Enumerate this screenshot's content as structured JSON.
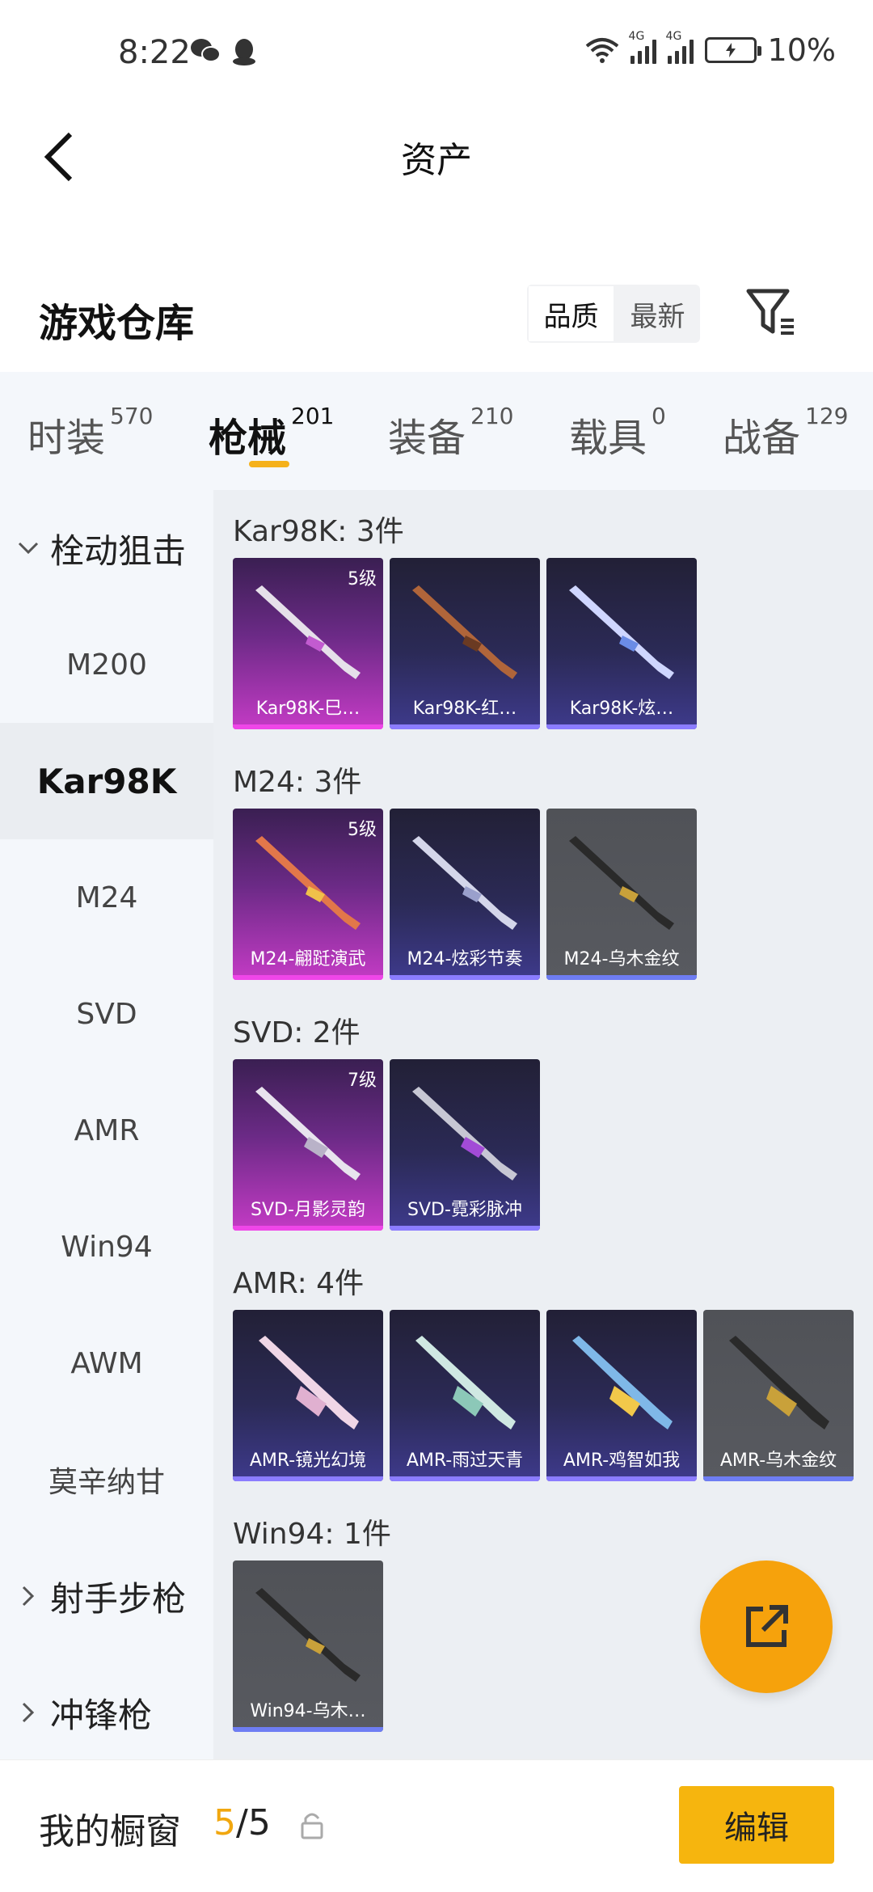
{
  "status_bar": {
    "time": "8:22",
    "battery_percent": "10%",
    "network_label_1": "4G",
    "network_label_2": "4G"
  },
  "header": {
    "title": "资产"
  },
  "warehouse": {
    "title": "游戏仓库",
    "sort_options": [
      "品质",
      "最新"
    ],
    "active_sort": "品质"
  },
  "tabs": [
    {
      "label": "时装",
      "count": "570"
    },
    {
      "label": "枪械",
      "count": "201",
      "active": true
    },
    {
      "label": "装备",
      "count": "210"
    },
    {
      "label": "载具",
      "count": "0"
    },
    {
      "label": "战备",
      "count": "129"
    }
  ],
  "sidebar": {
    "items": [
      {
        "label": "栓动狙击",
        "type": "group-expanded"
      },
      {
        "label": "M200"
      },
      {
        "label": "Kar98K",
        "selected": true
      },
      {
        "label": "M24"
      },
      {
        "label": "SVD"
      },
      {
        "label": "AMR"
      },
      {
        "label": "Win94"
      },
      {
        "label": "AWM"
      },
      {
        "label": "莫辛纳甘"
      },
      {
        "label": "射手步枪",
        "type": "group-collapsed"
      },
      {
        "label": "冲锋枪",
        "type": "group-collapsed"
      }
    ]
  },
  "sections": [
    {
      "title": "Kar98K: 3件",
      "items": [
        {
          "name": "Kar98K-巳…",
          "level": "5级",
          "rarity": "gold"
        },
        {
          "name": "Kar98K-红…",
          "level": "",
          "rarity": "purple"
        },
        {
          "name": "Kar98K-炫…",
          "level": "",
          "rarity": "purple"
        }
      ]
    },
    {
      "title": "M24: 3件",
      "items": [
        {
          "name": "M24-翩跹演武",
          "level": "5级",
          "rarity": "gold"
        },
        {
          "name": "M24-炫彩节奏",
          "level": "",
          "rarity": "purple"
        },
        {
          "name": "M24-乌木金纹",
          "level": "",
          "rarity": "gray"
        }
      ]
    },
    {
      "title": "SVD: 2件",
      "items": [
        {
          "name": "SVD-月影灵韵",
          "level": "7级",
          "rarity": "gold"
        },
        {
          "name": "SVD-霓彩脉冲",
          "level": "",
          "rarity": "purple"
        }
      ]
    },
    {
      "title": "AMR: 4件",
      "items": [
        {
          "name": "AMR-镜光幻境",
          "level": "",
          "rarity": "purple"
        },
        {
          "name": "AMR-雨过天青",
          "level": "",
          "rarity": "purple"
        },
        {
          "name": "AMR-鸡智如我",
          "level": "",
          "rarity": "purple"
        },
        {
          "name": "AMR-乌木金纹",
          "level": "",
          "rarity": "gray"
        }
      ]
    },
    {
      "title": "Win94: 1件",
      "items": [
        {
          "name": "Win94-乌木…",
          "level": "",
          "rarity": "gray"
        }
      ]
    }
  ],
  "bottom_bar": {
    "label": "我的橱窗",
    "current": "5",
    "separator": "/",
    "total": "5",
    "edit_label": "编辑"
  },
  "colors": {
    "accent": "#f6b50e",
    "tab_underline": "#f5b11a",
    "fab": "#f6a20c"
  }
}
